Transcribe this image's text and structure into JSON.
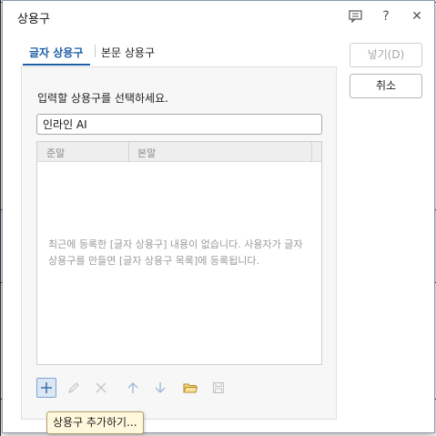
{
  "dialog": {
    "title": "상용구",
    "help_symbol": "?",
    "close_symbol": "✕"
  },
  "tabs": [
    {
      "label": "글자 상용구",
      "active": true
    },
    {
      "label": "본문 상용구",
      "active": false
    }
  ],
  "panel": {
    "prompt": "입력할 상용구를 선택하세요.",
    "search_value": "인라인 AI",
    "columns": [
      "준말",
      "본말"
    ],
    "empty_message": "최근에 등록한 [글자 상용구] 내용이 없습니다. 사용자가 글자 상용구를 만들면 [글자 상용구 목록]에 등록됩니다."
  },
  "toolbar": {
    "icons": [
      "add-icon",
      "edit-icon",
      "delete-icon",
      "move-up-icon",
      "move-down-icon",
      "open-folder-icon",
      "save-icon"
    ],
    "tooltip": "상용구 추가하기..."
  },
  "buttons": {
    "insert_label": "넣기(D)",
    "cancel_label": "취소"
  },
  "colors": {
    "accent": "#1f5fa8",
    "tooltip_bg": "#fff8dc",
    "disabled_text": "#a6a6a6"
  }
}
